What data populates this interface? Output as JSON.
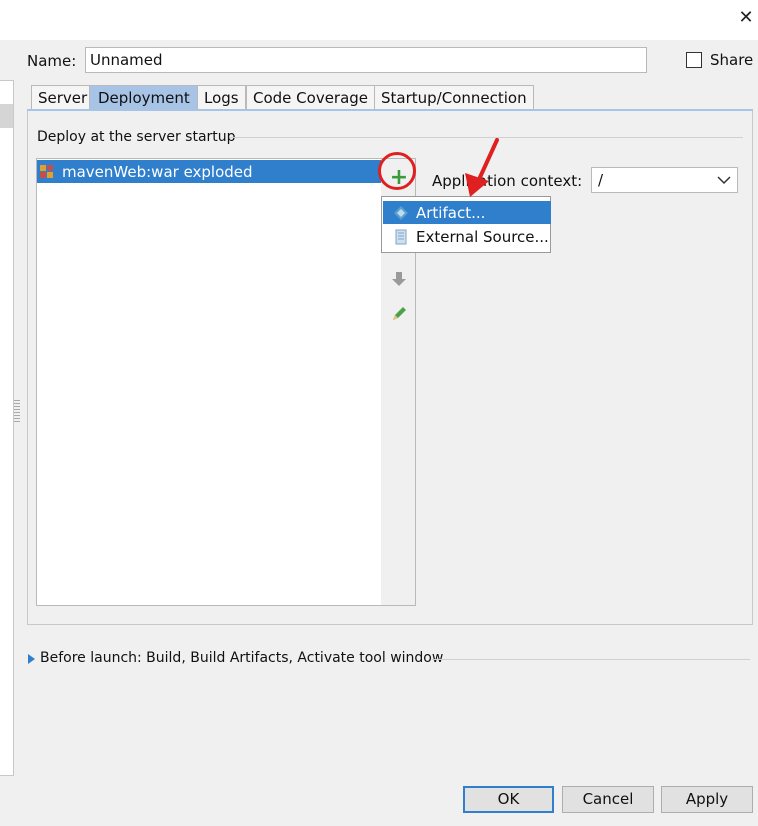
{
  "window": {
    "close_symbol": "✕"
  },
  "form": {
    "name_label": "Name:",
    "name_value": "Unnamed",
    "share_label": "Share",
    "share_checked": false
  },
  "tabs": [
    {
      "label": "Server",
      "active": false
    },
    {
      "label": "Deployment",
      "active": true
    },
    {
      "label": "Logs",
      "active": false
    },
    {
      "label": "Code Coverage",
      "active": false
    },
    {
      "label": "Startup/Connection",
      "active": false
    }
  ],
  "deploy": {
    "section_label": "Deploy at the server startup",
    "items": [
      {
        "label": "mavenWeb:war exploded",
        "icon": "war-artifact-icon",
        "selected": true
      }
    ],
    "toolbar": {
      "add_symbol": "+",
      "icons": [
        "add-icon",
        "move-down-icon",
        "edit-icon"
      ]
    }
  },
  "app_context": {
    "label": "Application context:",
    "value": "/"
  },
  "add_menu": {
    "items": [
      {
        "label": "Artifact...",
        "icon": "artifact-icon",
        "selected": true
      },
      {
        "label": "External Source...",
        "icon": "external-source-icon",
        "selected": false
      }
    ]
  },
  "before_launch": {
    "label": "Before launch: Build, Build Artifacts, Activate tool window"
  },
  "buttons": {
    "ok": "OK",
    "cancel": "Cancel",
    "apply": "Apply"
  },
  "colors": {
    "selection": "#2f7fcc",
    "tab_active": "#a7c3e6",
    "annotation_red": "#e02020",
    "add_green": "#3a9b3a"
  }
}
